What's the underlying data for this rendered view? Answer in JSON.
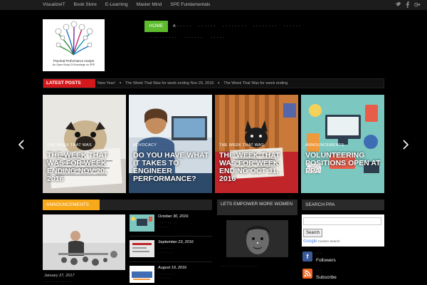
{
  "topbar": {
    "nav": [
      "VisualizeIT",
      "Book Store",
      "E-Learning",
      "Master Mind",
      "SPE Fundamentals"
    ],
    "social_icons": [
      "twitter-icon",
      "facebook-icon",
      "google-plus-icon"
    ]
  },
  "logo": {
    "title": "Practical Performance Analyst",
    "subtitle": "An Open Body Of Knowlege on SPE"
  },
  "mainnav": {
    "home": "HOME"
  },
  "ticker": {
    "label": "LATEST POSTS",
    "items": [
      "New Year!",
      "The Week That Was for week ending Nov 20, 2016",
      "The Week That Was for week ending"
    ]
  },
  "slides": [
    {
      "category": "THE WEEK THAT WAS",
      "title": "THE WEEK THAT WAS FOR WEEK ENDING NOV 20, 2016"
    },
    {
      "category": "ADVOCACY",
      "title": "DO YOU HAVE WHAT IT TAKES TO ENGINEER PERFORMANCE?"
    },
    {
      "category": "THE WEEK THAT WAS",
      "title": "THE WEEK THAT WAS FOR WEEK ENDING OCT 31, 2016"
    },
    {
      "category": "ANNOUNCEMENTS",
      "title": "VOLUNTEERING POSITIONS OPEN AT PPA"
    }
  ],
  "sections": {
    "announcements": "ANNOUNCEMENTS",
    "women": "LETS EMPOWER MORE WOMEN",
    "search": "SEARCH PPA"
  },
  "announcements": {
    "featured_date": "January 27, 2017",
    "list": [
      {
        "date": "October 30, 2016"
      },
      {
        "date": "September 23, 2016"
      },
      {
        "date": "August 19, 2016"
      }
    ]
  },
  "search": {
    "button": "Search",
    "google": "Google",
    "custom_search": "Custom Search"
  },
  "followers": [
    {
      "label": "Followers",
      "color": "#3b5998",
      "icon": "facebook-icon"
    },
    {
      "label": "Subscribe",
      "color": "#f26522",
      "icon": "rss-icon"
    }
  ]
}
